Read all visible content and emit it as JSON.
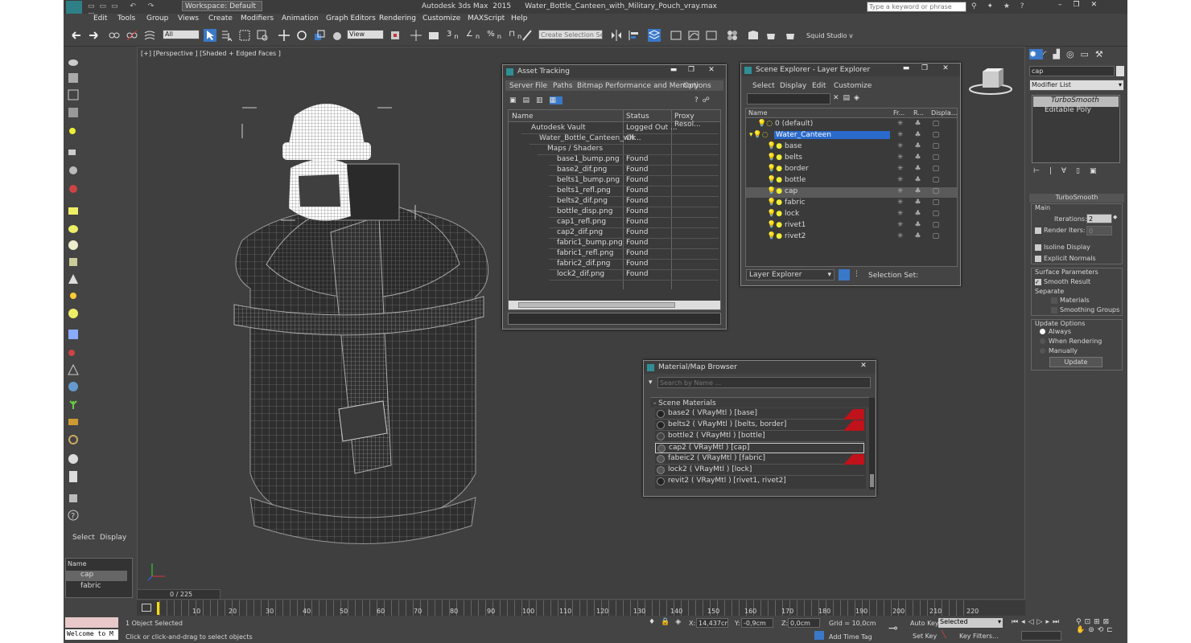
{
  "titlebar": {
    "workspace": "Workspace: Default",
    "title": "Autodesk 3ds Max  2015      Water_Bottle_Canteen_with_Military_Pouch_vray.max",
    "search_placeholder": "Type a keyword or phrase"
  },
  "menu": [
    "Edit",
    "Tools",
    "Group",
    "Views",
    "Create",
    "Modifiers",
    "Animation",
    "Graph Editors",
    "Rendering",
    "Customize",
    "MAXScript",
    "Help"
  ],
  "toolbar": {
    "filter_value": "All",
    "refcoord_value": "View",
    "selection_set_placeholder": "Create Selection Se",
    "user_label": "Squid Studio v"
  },
  "viewport": {
    "label": "[+] [Perspective ] [Shaded + Edged Faces ]"
  },
  "asset_tracking": {
    "title": "Asset Tracking",
    "menu": [
      "Server",
      "File",
      "Paths",
      "Bitmap Performance and Memory",
      "Options"
    ],
    "columns": [
      "Name",
      "Status",
      "Proxy Resol..."
    ],
    "rows": [
      {
        "name": "Autodesk Vault",
        "status": "Logged Out ..."
      },
      {
        "name": "Water_Bottle_Canteen_wit...",
        "status": "Ok"
      },
      {
        "name": "Maps / Shaders",
        "status": ""
      },
      {
        "name": "base1_bump.png",
        "status": "Found"
      },
      {
        "name": "base2_dif.png",
        "status": "Found"
      },
      {
        "name": "belts1_bump.png",
        "status": "Found"
      },
      {
        "name": "belts1_refl.png",
        "status": "Found"
      },
      {
        "name": "belts2_dif.png",
        "status": "Found"
      },
      {
        "name": "bottle_disp.png",
        "status": "Found"
      },
      {
        "name": "cap1_refl.png",
        "status": "Found"
      },
      {
        "name": "cap2_dif.png",
        "status": "Found"
      },
      {
        "name": "fabric1_bump.png",
        "status": "Found"
      },
      {
        "name": "fabric1_refl.png",
        "status": "Found"
      },
      {
        "name": "fabric2_dif.png",
        "status": "Found"
      },
      {
        "name": "lock2_dif.png",
        "status": "Found"
      }
    ]
  },
  "scene_explorer": {
    "title": "Scene Explorer - Layer Explorer",
    "menu": [
      "Select",
      "Display",
      "Edit",
      "Customize"
    ],
    "columns": [
      "Name",
      "Fr...",
      "R...",
      "Displa..."
    ],
    "rows": [
      "0 (default)",
      "Water_Canteen",
      "base",
      "belts",
      "border",
      "bottle",
      "cap",
      "fabric",
      "lock",
      "rivet1",
      "rivet2"
    ],
    "footer_dropdown": "Layer Explorer",
    "footer_label": "Selection Set:"
  },
  "material_browser": {
    "title": "Material/Map Browser",
    "search_placeholder": "Search by Name ...",
    "group": "- Scene Materials",
    "items": [
      "base2  ( VRayMtl )  [base]",
      "belts2  ( VRayMtl )  [belts, border]",
      "bottle2  ( VRayMtl )  [bottle]",
      "cap2  ( VRayMtl )  [cap]",
      "fabeic2  ( VRayMtl )  [fabric]",
      "lock2  ( VRayMtl )  [lock]",
      "revit2  ( VRayMtl )  [rivet1, rivet2]"
    ]
  },
  "command_panel": {
    "object_name": "cap",
    "modifier_list": "Modifier List",
    "stack": [
      "TurboSmooth",
      "Editable Poly"
    ],
    "rollout_title": "TurboSmooth",
    "main_label": "Main",
    "iterations_label": "Iterations:",
    "iterations_value": "2",
    "render_iters_label": "Render Iters:",
    "render_iters_value": "0",
    "isoline": "Isoline Display",
    "explicit": "Explicit Normals",
    "surface_params": "Surface Parameters",
    "smooth_result": "Smooth Result",
    "separate": "Separate",
    "materials": "Materials",
    "smoothing_groups": "Smoothing Groups",
    "update_options": "Update Options",
    "always": "Always",
    "when_rendering": "When Rendering",
    "manually": "Manually",
    "update_button": "Update"
  },
  "left_panel": {
    "tabs": [
      "Select",
      "Display"
    ],
    "name_header": "Name",
    "items": [
      "cap",
      "fabric"
    ],
    "frame_counter": "0 / 225"
  },
  "timeline": {
    "ticks": [
      "10",
      "20",
      "30",
      "40",
      "50",
      "60",
      "70",
      "80",
      "90",
      "100",
      "110",
      "120",
      "130",
      "140",
      "150",
      "160",
      "170",
      "180",
      "190",
      "200",
      "210",
      "220"
    ]
  },
  "status": {
    "maxscript": "Welcome to M",
    "selected": "1 Object Selected",
    "prompt": "Click or click-and-drag to select objects",
    "x_label": "X:",
    "x_value": "14,437cm",
    "y_label": "Y:",
    "y_value": "-0,9cm",
    "z_label": "Z:",
    "z_value": "0,0cm",
    "grid": "Grid = 10,0cm",
    "add_time_tag": "Add Time Tag",
    "auto_key": "Auto Key",
    "selected_dd": "Selected",
    "set_key": "Set Key",
    "key_filters": "Key Filters..."
  },
  "colors": {
    "app_bg": "#444444",
    "viewport_bg": "#3f3f3f",
    "selection_blue": "#2a6acb",
    "accent_red": "#c0121a"
  }
}
